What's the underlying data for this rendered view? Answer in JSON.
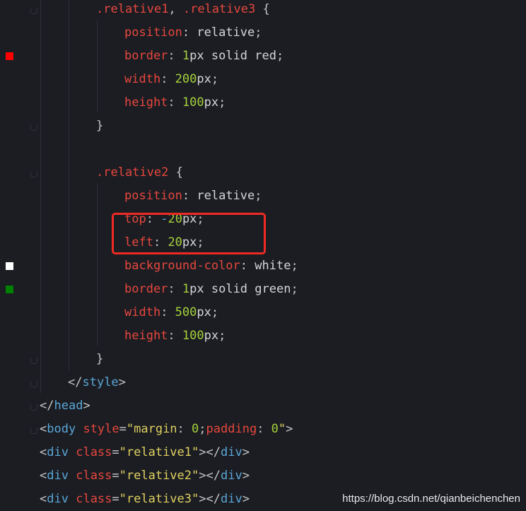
{
  "theme": {
    "background": "#1b1d23",
    "plain": "#d6d6d6",
    "punct": "#c5c5c5",
    "selector": "#e8473d",
    "property": "#e8473d",
    "number": "#a6d13a",
    "string": "#e0d15f",
    "tag": "#5aa6d6",
    "attr": "#e8473d",
    "operator": "#5aa6d6",
    "highlight_border": "#ee2a23"
  },
  "editor": {
    "lines": [
      {
        "indent": 136,
        "marker": null,
        "fold": true,
        "tokens": [
          [
            "selector",
            ".relative1"
          ],
          [
            "punct",
            ", "
          ],
          [
            "selector",
            ".relative3"
          ],
          [
            "punct",
            " {"
          ]
        ]
      },
      {
        "indent": 176,
        "marker": null,
        "fold": false,
        "tokens": [
          [
            "property",
            "position"
          ],
          [
            "punct",
            ": "
          ],
          [
            "plain",
            "relative"
          ],
          [
            "punct",
            ";"
          ]
        ]
      },
      {
        "indent": 176,
        "marker": "#ff0000",
        "fold": false,
        "tokens": [
          [
            "property",
            "border"
          ],
          [
            "punct",
            ": "
          ],
          [
            "number",
            "1"
          ],
          [
            "plain",
            "px solid red"
          ],
          [
            "punct",
            ";"
          ]
        ]
      },
      {
        "indent": 176,
        "marker": null,
        "fold": false,
        "tokens": [
          [
            "property",
            "width"
          ],
          [
            "punct",
            ": "
          ],
          [
            "number",
            "200"
          ],
          [
            "plain",
            "px"
          ],
          [
            "punct",
            ";"
          ]
        ]
      },
      {
        "indent": 176,
        "marker": null,
        "fold": false,
        "tokens": [
          [
            "property",
            "height"
          ],
          [
            "punct",
            ": "
          ],
          [
            "number",
            "100"
          ],
          [
            "plain",
            "px"
          ],
          [
            "punct",
            ";"
          ]
        ]
      },
      {
        "indent": 136,
        "marker": null,
        "fold": true,
        "tokens": [
          [
            "punct",
            "}"
          ]
        ]
      },
      {
        "indent": 136,
        "marker": null,
        "fold": false,
        "tokens": []
      },
      {
        "indent": 136,
        "marker": null,
        "fold": true,
        "tokens": [
          [
            "selector",
            ".relative2"
          ],
          [
            "punct",
            " {"
          ]
        ]
      },
      {
        "indent": 176,
        "marker": null,
        "fold": false,
        "tokens": [
          [
            "property",
            "position"
          ],
          [
            "punct",
            ": "
          ],
          [
            "plain",
            "relative"
          ],
          [
            "punct",
            ";"
          ]
        ]
      },
      {
        "indent": 176,
        "marker": null,
        "fold": false,
        "tokens": [
          [
            "property",
            "top"
          ],
          [
            "punct",
            ": "
          ],
          [
            "operator",
            "-"
          ],
          [
            "number",
            "20"
          ],
          [
            "plain",
            "px"
          ],
          [
            "punct",
            ";"
          ]
        ]
      },
      {
        "indent": 176,
        "marker": null,
        "fold": false,
        "tokens": [
          [
            "property",
            "left"
          ],
          [
            "punct",
            ": "
          ],
          [
            "number",
            "20"
          ],
          [
            "plain",
            "px"
          ],
          [
            "punct",
            ";"
          ]
        ]
      },
      {
        "indent": 176,
        "marker": "#ffffff",
        "fold": false,
        "tokens": [
          [
            "property",
            "background-color"
          ],
          [
            "punct",
            ": "
          ],
          [
            "plain",
            "white"
          ],
          [
            "punct",
            ";"
          ]
        ]
      },
      {
        "indent": 176,
        "marker": "#008000",
        "fold": false,
        "tokens": [
          [
            "property",
            "border"
          ],
          [
            "punct",
            ": "
          ],
          [
            "number",
            "1"
          ],
          [
            "plain",
            "px solid green"
          ],
          [
            "punct",
            ";"
          ]
        ]
      },
      {
        "indent": 176,
        "marker": null,
        "fold": false,
        "tokens": [
          [
            "property",
            "width"
          ],
          [
            "punct",
            ": "
          ],
          [
            "number",
            "500"
          ],
          [
            "plain",
            "px"
          ],
          [
            "punct",
            ";"
          ]
        ]
      },
      {
        "indent": 176,
        "marker": null,
        "fold": false,
        "tokens": [
          [
            "property",
            "height"
          ],
          [
            "punct",
            ": "
          ],
          [
            "number",
            "100"
          ],
          [
            "plain",
            "px"
          ],
          [
            "punct",
            ";"
          ]
        ]
      },
      {
        "indent": 136,
        "marker": null,
        "fold": true,
        "tokens": [
          [
            "punct",
            "}"
          ]
        ]
      },
      {
        "indent": 96,
        "marker": null,
        "fold": true,
        "tokens": [
          [
            "punct",
            "</"
          ],
          [
            "tag",
            "style"
          ],
          [
            "punct",
            ">"
          ]
        ]
      },
      {
        "indent": 56,
        "marker": null,
        "fold": true,
        "tokens": [
          [
            "punct",
            "</"
          ],
          [
            "tag",
            "head"
          ],
          [
            "punct",
            ">"
          ]
        ]
      },
      {
        "indent": 56,
        "marker": null,
        "fold": true,
        "tokens": [
          [
            "punct",
            "<"
          ],
          [
            "tag",
            "body"
          ],
          [
            "plain",
            " "
          ],
          [
            "attr",
            "style"
          ],
          [
            "punct",
            "="
          ],
          [
            "string",
            "\"margin"
          ],
          [
            "punct",
            ": "
          ],
          [
            "number",
            "0"
          ],
          [
            "punct",
            ";"
          ],
          [
            "attr",
            "padding"
          ],
          [
            "punct",
            ": "
          ],
          [
            "number",
            "0"
          ],
          [
            "string",
            "\""
          ],
          [
            "punct",
            ">"
          ]
        ]
      },
      {
        "indent": 56,
        "marker": null,
        "fold": false,
        "tokens": [
          [
            "punct",
            "<"
          ],
          [
            "tag",
            "div"
          ],
          [
            "plain",
            " "
          ],
          [
            "attr",
            "class"
          ],
          [
            "punct",
            "="
          ],
          [
            "string",
            "\"relative1\""
          ],
          [
            "punct",
            "></"
          ],
          [
            "tag",
            "div"
          ],
          [
            "punct",
            ">"
          ]
        ]
      },
      {
        "indent": 56,
        "marker": null,
        "fold": false,
        "tokens": [
          [
            "punct",
            "<"
          ],
          [
            "tag",
            "div"
          ],
          [
            "plain",
            " "
          ],
          [
            "attr",
            "class"
          ],
          [
            "punct",
            "="
          ],
          [
            "string",
            "\"relative2\""
          ],
          [
            "punct",
            "></"
          ],
          [
            "tag",
            "div"
          ],
          [
            "punct",
            ">"
          ]
        ]
      },
      {
        "indent": 56,
        "marker": null,
        "fold": false,
        "tokens": [
          [
            "punct",
            "<"
          ],
          [
            "tag",
            "div"
          ],
          [
            "plain",
            " "
          ],
          [
            "attr",
            "class"
          ],
          [
            "punct",
            "="
          ],
          [
            "string",
            "\"relative3\""
          ],
          [
            "punct",
            "></"
          ],
          [
            "tag",
            "div"
          ],
          [
            "punct",
            ">"
          ]
        ]
      }
    ]
  },
  "watermark": "https://blog.csdn.net/qianbeichenchen"
}
